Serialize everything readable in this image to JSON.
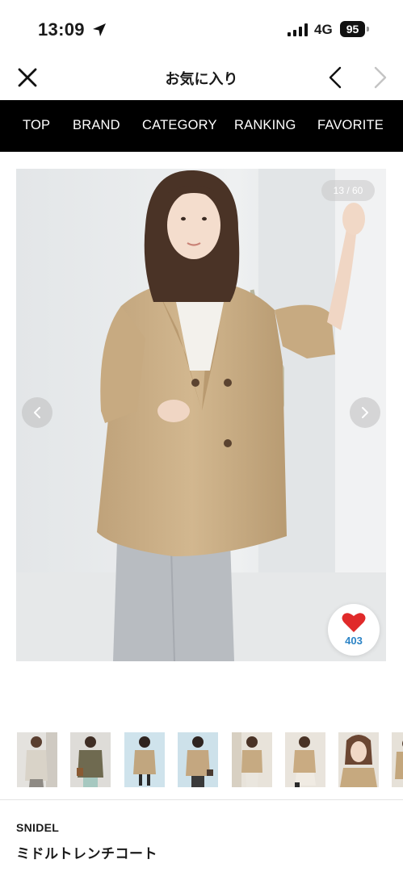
{
  "status_bar": {
    "time": "13:09",
    "network": "4G",
    "battery": "95"
  },
  "header": {
    "title": "お気に入り"
  },
  "nav": {
    "items": [
      "TOP",
      "BRAND",
      "CATEGORY",
      "RANKING",
      "FAVORITE"
    ]
  },
  "gallery": {
    "counter": "13 / 60",
    "like_count": "403"
  },
  "product": {
    "brand": "SNIDEL",
    "name": "ミドルトレンチコート"
  },
  "colors": {
    "nav_bg": "#000000",
    "like_heart": "#e02a2a",
    "like_count": "#2c84c6",
    "coat": "#c9ad86"
  }
}
